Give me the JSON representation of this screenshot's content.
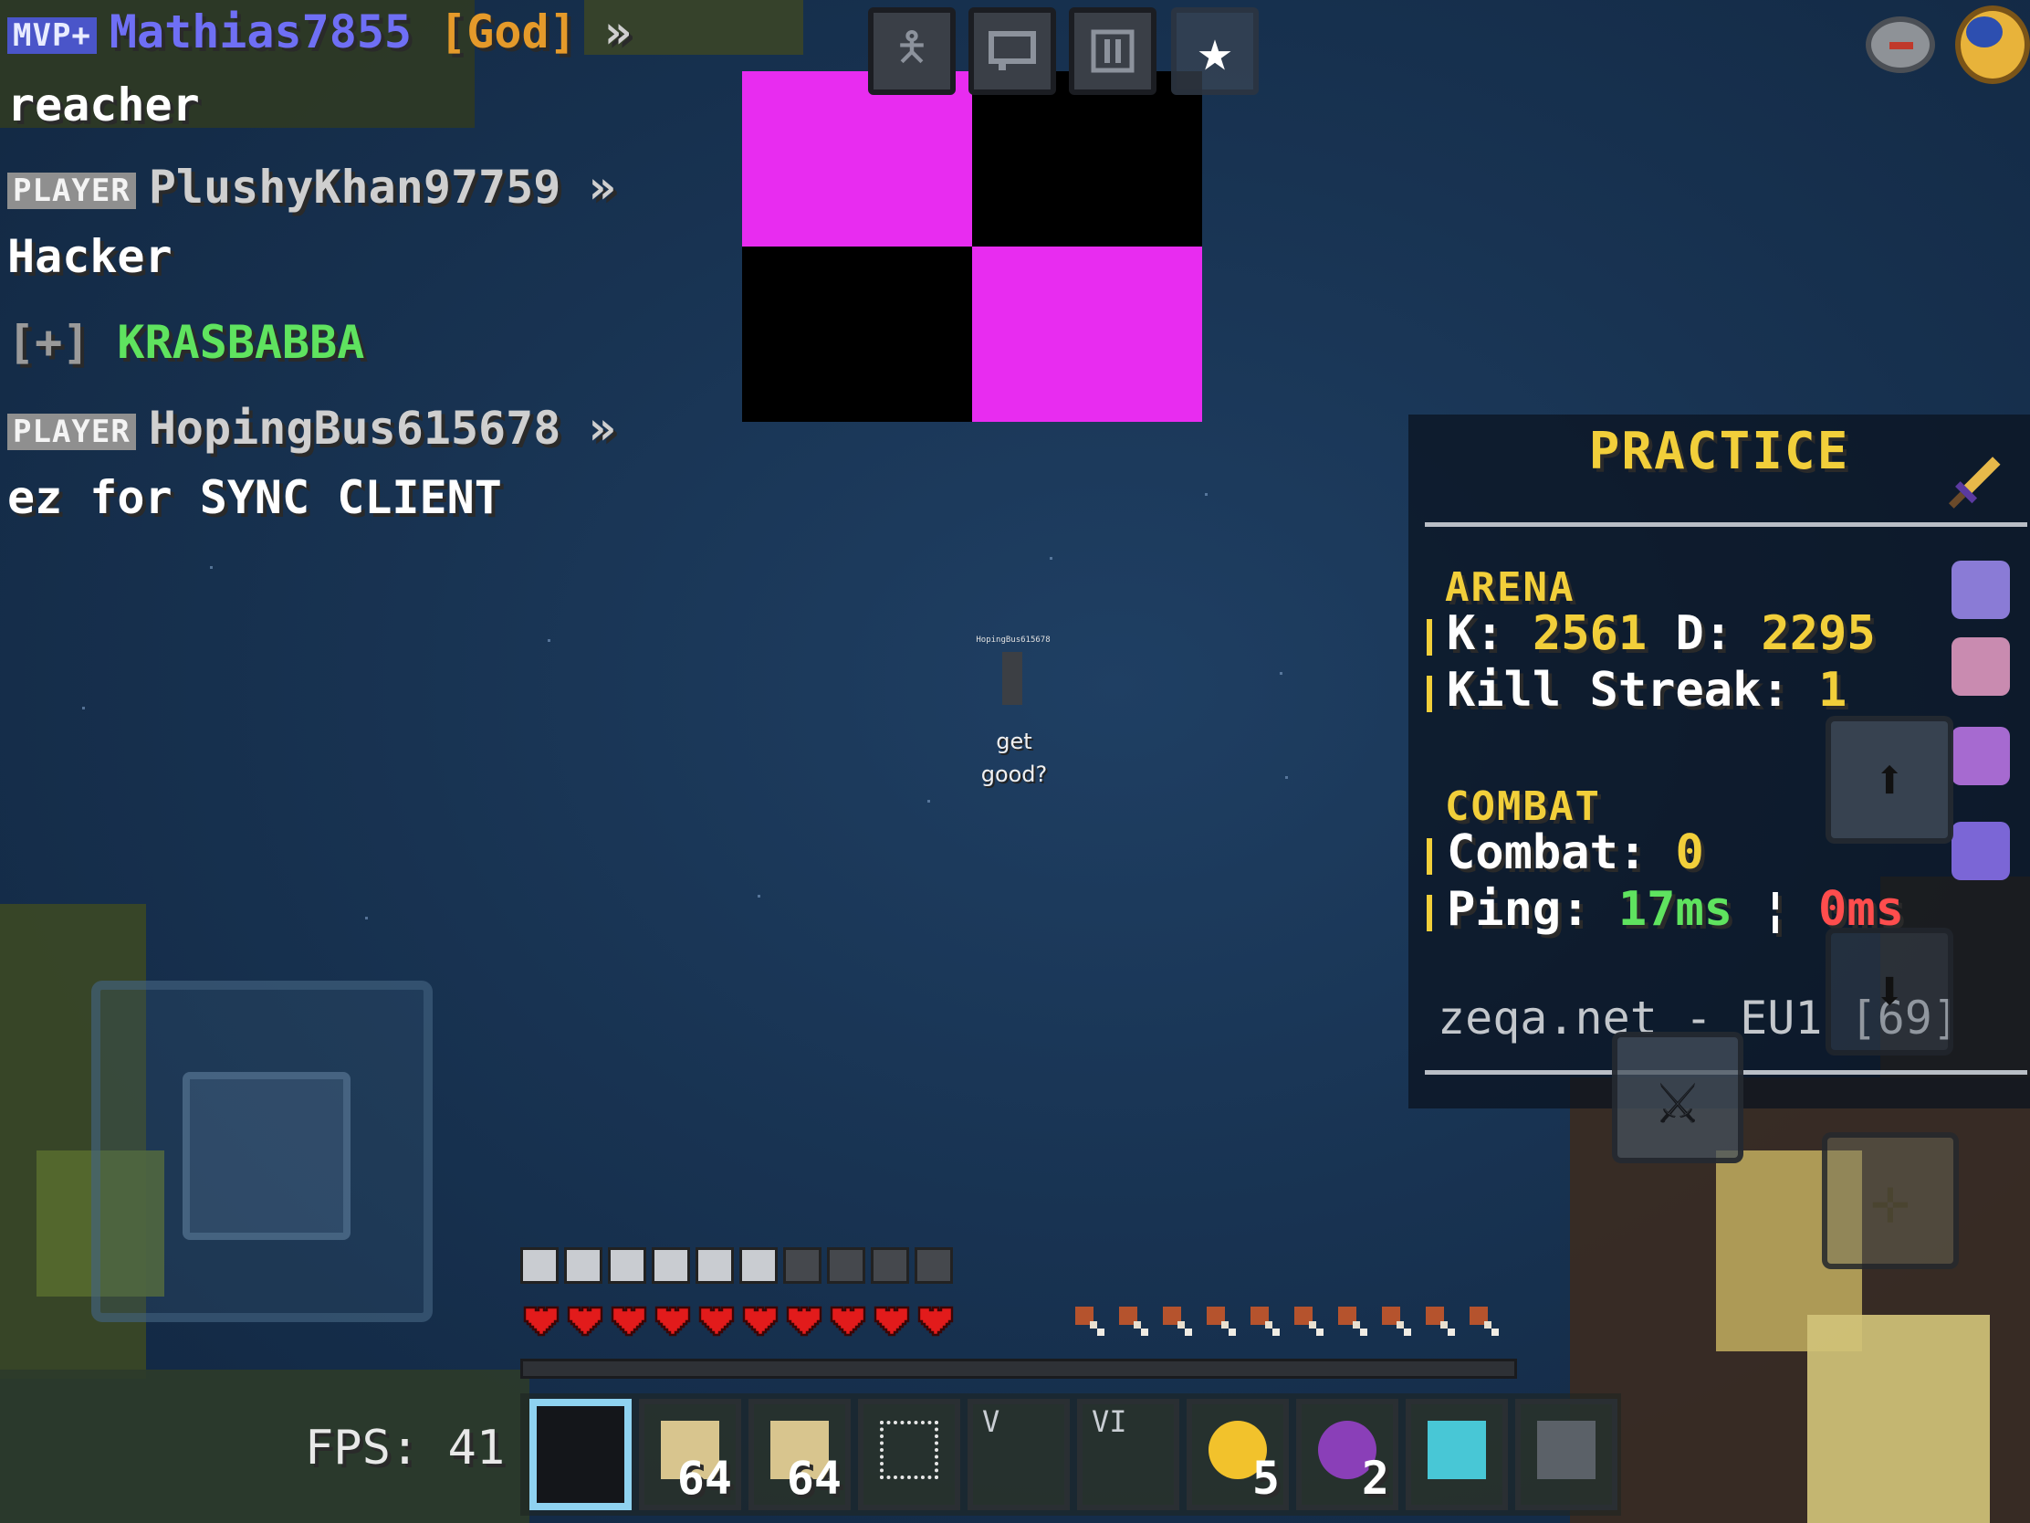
{
  "chat": [
    {
      "rank": "MVP+",
      "name": "Mathias7855",
      "tag": "[God]",
      "sep": "»",
      "message": "reacher"
    },
    {
      "rank": "PLAYER",
      "name": "PlushyKhan97759",
      "sep": "»",
      "message": "Hacker"
    },
    {
      "prefix": "[+]",
      "name": "KRASBABBA"
    },
    {
      "rank": "PLAYER",
      "name": "HopingBus615678",
      "sep": "»",
      "message": "ez for SYNC CLIENT"
    }
  ],
  "top_buttons": [
    "emote-icon",
    "chat-icon",
    "pause-icon",
    "star-icon"
  ],
  "opponent": {
    "nametag": "HopingBus615678",
    "caption": "get good?"
  },
  "scoreboard": {
    "title": "PRACTICE",
    "arena_header": "ARENA",
    "kills_label": "K:",
    "kills": "2561",
    "deaths_label": "D:",
    "deaths": "2295",
    "streak_label": "Kill Streak:",
    "streak": "1",
    "combat_header": "COMBAT",
    "combat_label": "Combat:",
    "combat_value": "0",
    "ping_label": "Ping:",
    "ping_value": "17ms",
    "ping_sep": "¦",
    "ping_extra": "0ms",
    "server": "zeqa.net - EU1 [69]"
  },
  "fps": "FPS: 41",
  "hud": {
    "hearts": 10,
    "armor_full": 6,
    "armor_total": 10,
    "food": 10
  },
  "hotbar": [
    {
      "item": "empty-selected",
      "count": "",
      "roman": ""
    },
    {
      "item": "sandstone-icon",
      "count": "64",
      "roman": ""
    },
    {
      "item": "sandstone-icon",
      "count": "64",
      "roman": ""
    },
    {
      "item": "cobweb-icon",
      "count": "",
      "roman": ""
    },
    {
      "item": "empty",
      "count": "",
      "roman": "V"
    },
    {
      "item": "empty",
      "count": "",
      "roman": "VI"
    },
    {
      "item": "golden-apple-icon",
      "count": "5",
      "roman": ""
    },
    {
      "item": "ender-pearl-icon",
      "count": "2",
      "roman": ""
    },
    {
      "item": "diamond-pickaxe-icon",
      "count": "",
      "roman": ""
    },
    {
      "item": "more-icon",
      "count": "",
      "roman": ""
    }
  ],
  "colors": {
    "mvp_name": "#6f6ff5",
    "god_tag": "#e59a2a",
    "player_name": "#cfcfcf",
    "plus_name": "#5fe35f",
    "gold": "#f2cf3a"
  }
}
